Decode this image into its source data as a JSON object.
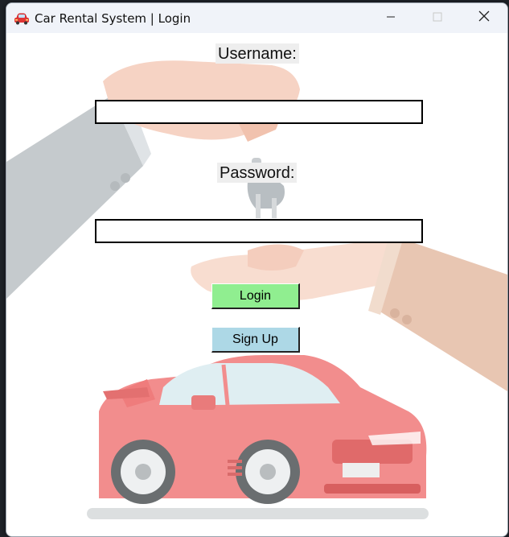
{
  "window": {
    "title": "Car Rental System | Login",
    "app_icon": "red-car-icon",
    "controls": [
      "minimize-icon",
      "maximize-icon",
      "close-icon"
    ]
  },
  "form": {
    "username_label": "Username:",
    "username_value": "",
    "password_label": "Password:",
    "password_value": "",
    "login_label": "Login",
    "signup_label": "Sign Up"
  },
  "colors": {
    "login_button": "#90ee90",
    "signup_button": "#add8e6",
    "titlebar": "#f0f3f9",
    "label_bg": "#eeeeee"
  },
  "background_image": "hand-passing-car-keys-over-red-sports-car"
}
